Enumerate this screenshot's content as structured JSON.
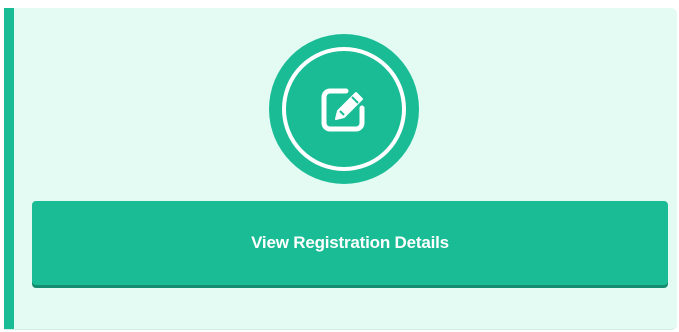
{
  "card": {
    "accent_color": "#1abc96",
    "background_color": "#e4fbf3",
    "icon": "edit-icon",
    "button_label": "View Registration Details"
  }
}
